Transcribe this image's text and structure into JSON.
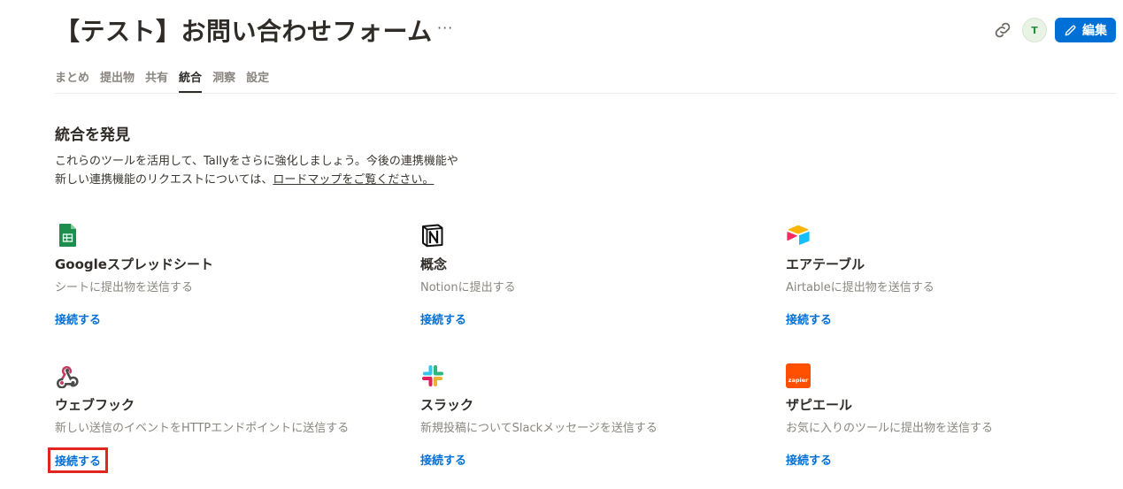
{
  "header": {
    "title": "【テスト】お問い合わせフォーム",
    "more_label": "···",
    "avatar_initial": "T",
    "edit_label": "編集"
  },
  "tabs": [
    {
      "label": "まとめ",
      "active": false
    },
    {
      "label": "提出物",
      "active": false
    },
    {
      "label": "共有",
      "active": false
    },
    {
      "label": "統合",
      "active": true
    },
    {
      "label": "洞察",
      "active": false
    },
    {
      "label": "設定",
      "active": false
    }
  ],
  "section": {
    "title": "統合を発見",
    "intro_line1": "これらのツールを活用して、Tallyをさらに強化しましょう。今後の連携機能や",
    "intro_line2_prefix": "新しい連携機能のリクエストについては、",
    "intro_link": "ロードマップをご覧ください。"
  },
  "integrations": [
    {
      "icon": "google-sheets-icon",
      "title": "Googleスプレッドシート",
      "desc": "シートに提出物を送信する",
      "connect": "接続する"
    },
    {
      "icon": "notion-icon",
      "title": "概念",
      "desc": "Notionに提出する",
      "connect": "接続する"
    },
    {
      "icon": "airtable-icon",
      "title": "エアテーブル",
      "desc": "Airtableに提出物を送信する",
      "connect": "接続する"
    },
    {
      "icon": "webhook-icon",
      "title": "ウェブフック",
      "desc": "新しい送信のイベントをHTTPエンドポイントに送信する",
      "connect": "接続する"
    },
    {
      "icon": "slack-icon",
      "title": "スラック",
      "desc": "新規投稿についてSlackメッセージを送信する",
      "connect": "接続する"
    },
    {
      "icon": "zapier-icon",
      "title": "ザピエール",
      "desc": "お気に入りのツールに提出物を送信する",
      "connect": "接続する",
      "icon_text": "zapier"
    }
  ],
  "colors": {
    "accent": "#0070d7",
    "highlight": "#e0261f",
    "zapier": "#ff4f00"
  }
}
